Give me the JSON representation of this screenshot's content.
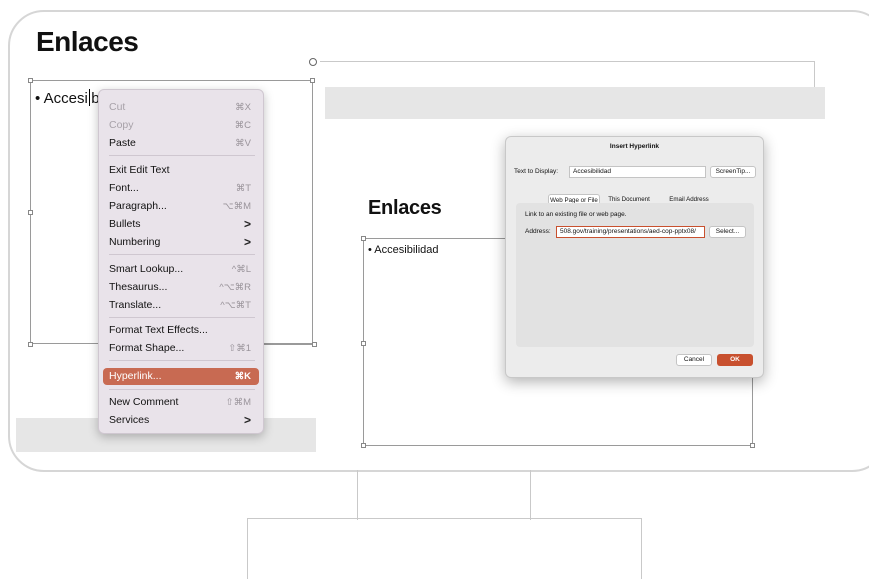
{
  "slide_left": {
    "title": "Enlaces",
    "bullet_before_caret": "• Accesi",
    "bullet_after_caret": "bilidad"
  },
  "context_menu": {
    "items": [
      {
        "label": "Cut",
        "shortcut": "⌘X",
        "disabled": true
      },
      {
        "label": "Copy",
        "shortcut": "⌘C",
        "disabled": true
      },
      {
        "label": "Paste",
        "shortcut": "⌘V"
      },
      {
        "label": "Exit Edit Text",
        "shortcut": ""
      },
      {
        "label": "Font...",
        "shortcut": "⌘T"
      },
      {
        "label": "Paragraph...",
        "shortcut": "⌥⌘M"
      },
      {
        "label": "Bullets",
        "shortcut": ">",
        "submenu": true
      },
      {
        "label": "Numbering",
        "shortcut": ">",
        "submenu": true
      },
      {
        "label": "Smart Lookup...",
        "shortcut": "^⌘L"
      },
      {
        "label": "Thesaurus...",
        "shortcut": "^⌥⌘R"
      },
      {
        "label": "Translate...",
        "shortcut": "^⌥⌘T"
      },
      {
        "label": "Format Text Effects...",
        "shortcut": ""
      },
      {
        "label": "Format Shape...",
        "shortcut": "⇧⌘1"
      },
      {
        "label": "Hyperlink...",
        "shortcut": "⌘K",
        "highlighted": true
      },
      {
        "label": "New Comment",
        "shortcut": "⇧⌘M"
      },
      {
        "label": "Services",
        "shortcut": ">",
        "submenu": true
      }
    ]
  },
  "slide_right": {
    "title": "Enlaces",
    "bullet": "• Accesibilidad"
  },
  "dialog": {
    "title": "Insert Hyperlink",
    "text_to_display_label": "Text to Display:",
    "text_to_display_value": "Accesibilidad",
    "screentip_button": "ScreenTip...",
    "tabs": [
      "Web Page or File",
      "This Document",
      "Email Address"
    ],
    "active_tab": "Web Page or File",
    "hint": "Link to an existing file or web page.",
    "address_label": "Address:",
    "address_value": "508.gov/training/presentations/aed-cop-pptx08/",
    "select_button": "Select...",
    "cancel_button": "Cancel",
    "ok_button": "OK",
    "colors": {
      "ok": "#c8502e",
      "highlight": "#c86a52"
    }
  }
}
